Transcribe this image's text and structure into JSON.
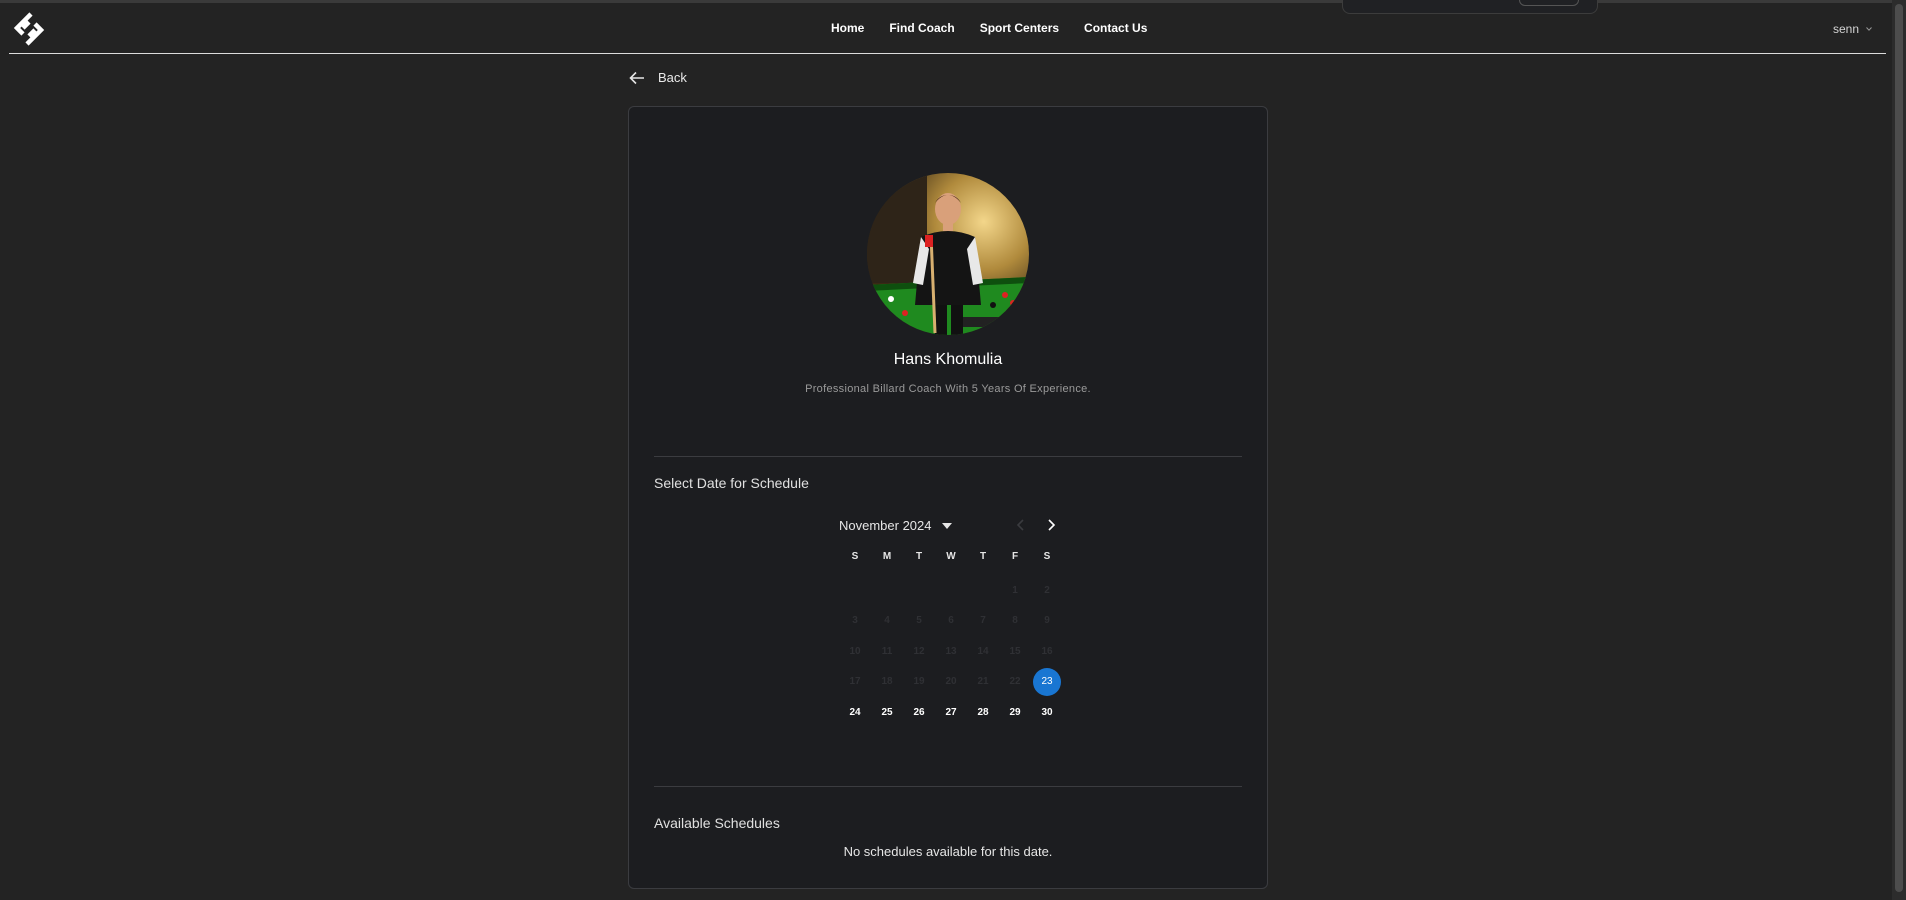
{
  "nav": {
    "links": [
      "Home",
      "Find Coach",
      "Sport Centers",
      "Contact Us"
    ],
    "user": "senn"
  },
  "back_label": "Back",
  "coach": {
    "name": "Hans Khomulia",
    "bio": "Professional Billard Coach With 5 Years Of Experience."
  },
  "schedule": {
    "title": "Select Date for Schedule",
    "month_label": "November 2024",
    "weekdays": [
      "S",
      "M",
      "T",
      "W",
      "T",
      "F",
      "S"
    ],
    "leading_blanks": 5,
    "days_in_month": 30,
    "disabled_before": 23,
    "selected_day": 23
  },
  "available": {
    "title": "Available Schedules",
    "empty_message": "No schedules available for this date."
  },
  "colors": {
    "background": "#232323",
    "card": "#1c1d20",
    "accent": "#1976d2"
  }
}
